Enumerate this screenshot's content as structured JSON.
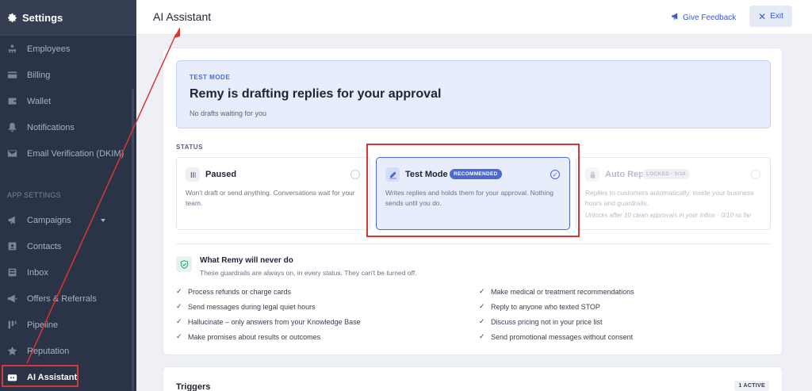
{
  "sidebar": {
    "header": "Settings",
    "items": [
      {
        "label": "Employees",
        "icon": "employees-icon"
      },
      {
        "label": "Billing",
        "icon": "billing-icon"
      },
      {
        "label": "Wallet",
        "icon": "wallet-icon"
      },
      {
        "label": "Notifications",
        "icon": "bell-icon"
      },
      {
        "label": "Email Verification (DKIM)",
        "icon": "mail-check-icon"
      }
    ],
    "section": "APP SETTINGS",
    "app_items": [
      {
        "label": "Campaigns",
        "icon": "megaphone-icon"
      },
      {
        "label": "Contacts",
        "icon": "contact-card-icon"
      },
      {
        "label": "Inbox",
        "icon": "inbox-icon"
      },
      {
        "label": "Offers & Referrals",
        "icon": "offers-icon"
      },
      {
        "label": "Pipeline",
        "icon": "pipeline-icon"
      },
      {
        "label": "Reputation",
        "icon": "star-icon"
      },
      {
        "label": "AI Assistant",
        "icon": "robot-icon"
      }
    ]
  },
  "topbar": {
    "title": "AI Assistant",
    "feedback": "Give Feedback",
    "exit": "Exit"
  },
  "banner": {
    "mode": "TEST MODE",
    "headline": "Remy is drafting replies for your approval",
    "sub": "No drafts waiting for you"
  },
  "status": {
    "label": "STATUS",
    "cards": [
      {
        "title": "Paused",
        "desc": "Won't draft or send anything. Conversations wait for your team."
      },
      {
        "title": "Test Mode",
        "badge": "RECOMMENDED",
        "desc": "Writes replies and holds them for your approval. Nothing sends until you do."
      },
      {
        "title": "Auto Reply",
        "badge": "LOCKED · 0/10",
        "desc": "Replies to customers automatically, inside your business hours and guardrails.",
        "note": "Unlocks after 10 clean approvals in your Inbox · 0/10 so far"
      }
    ]
  },
  "never": {
    "title": "What Remy will never do",
    "sub": "These guardrails are always on, in every status. They can't be turned off.",
    "left": [
      "Process refunds or charge cards",
      "Send messages during legal quiet hours",
      "Hallucinate – only answers from your Knowledge Base",
      "Make promises about results or outcomes"
    ],
    "right": [
      "Make medical or treatment recommendations",
      "Reply to anyone who texted STOP",
      "Discuss pricing not in your price list",
      "Send promotional messages without consent"
    ]
  },
  "triggers": {
    "title": "Triggers",
    "active": "1 ACTIVE"
  },
  "colors": {
    "sidebar": "#2b3346",
    "accent": "#4a68d6",
    "annotation": "#d93636"
  }
}
